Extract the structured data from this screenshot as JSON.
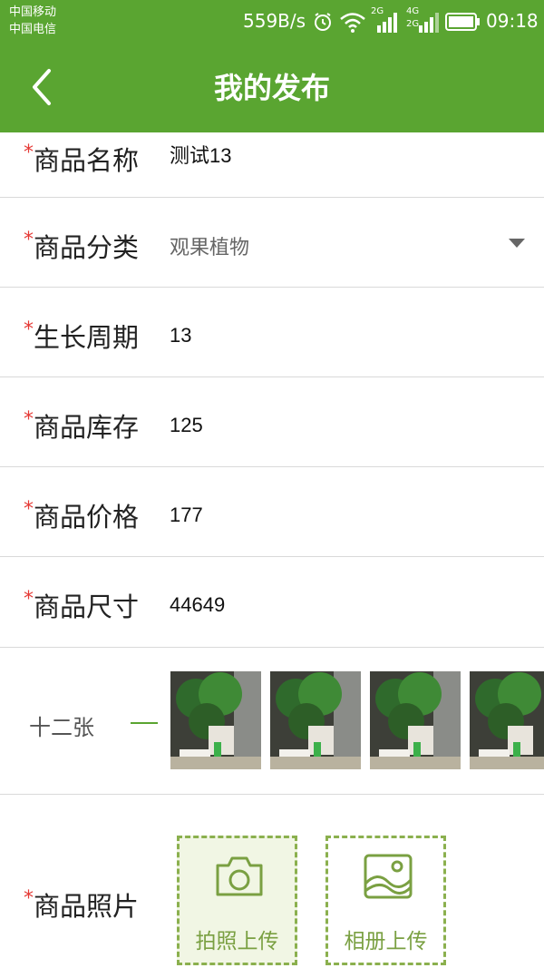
{
  "status_bar": {
    "carrier_1": "中国移动",
    "carrier_2": "中国电信",
    "net_speed": "559B/s",
    "sim1_net": "2G",
    "sim2_net_top": "4G",
    "sim2_net_bottom": "2G",
    "time": "09:18"
  },
  "app_bar": {
    "title": "我的发布",
    "back_icon": "chevron-left-icon"
  },
  "form": {
    "required_mark": "*",
    "name": {
      "label": "商品名称",
      "value": "测试13"
    },
    "category": {
      "label": "商品分类",
      "value": "观果植物"
    },
    "growth": {
      "label": "生长周期",
      "value": "13"
    },
    "stock": {
      "label": "商品库存",
      "value": "125"
    },
    "price": {
      "label": "商品价格",
      "value": "177"
    },
    "size": {
      "label": "商品尺寸",
      "value": "44649"
    }
  },
  "gallery": {
    "count_label": "十二张"
  },
  "photo": {
    "label": "商品照片",
    "camera_button": "拍照上传",
    "album_button": "相册上传"
  },
  "colors": {
    "accent": "#5aa531",
    "required": "#e53935",
    "dashed_border": "#8bb04e"
  }
}
